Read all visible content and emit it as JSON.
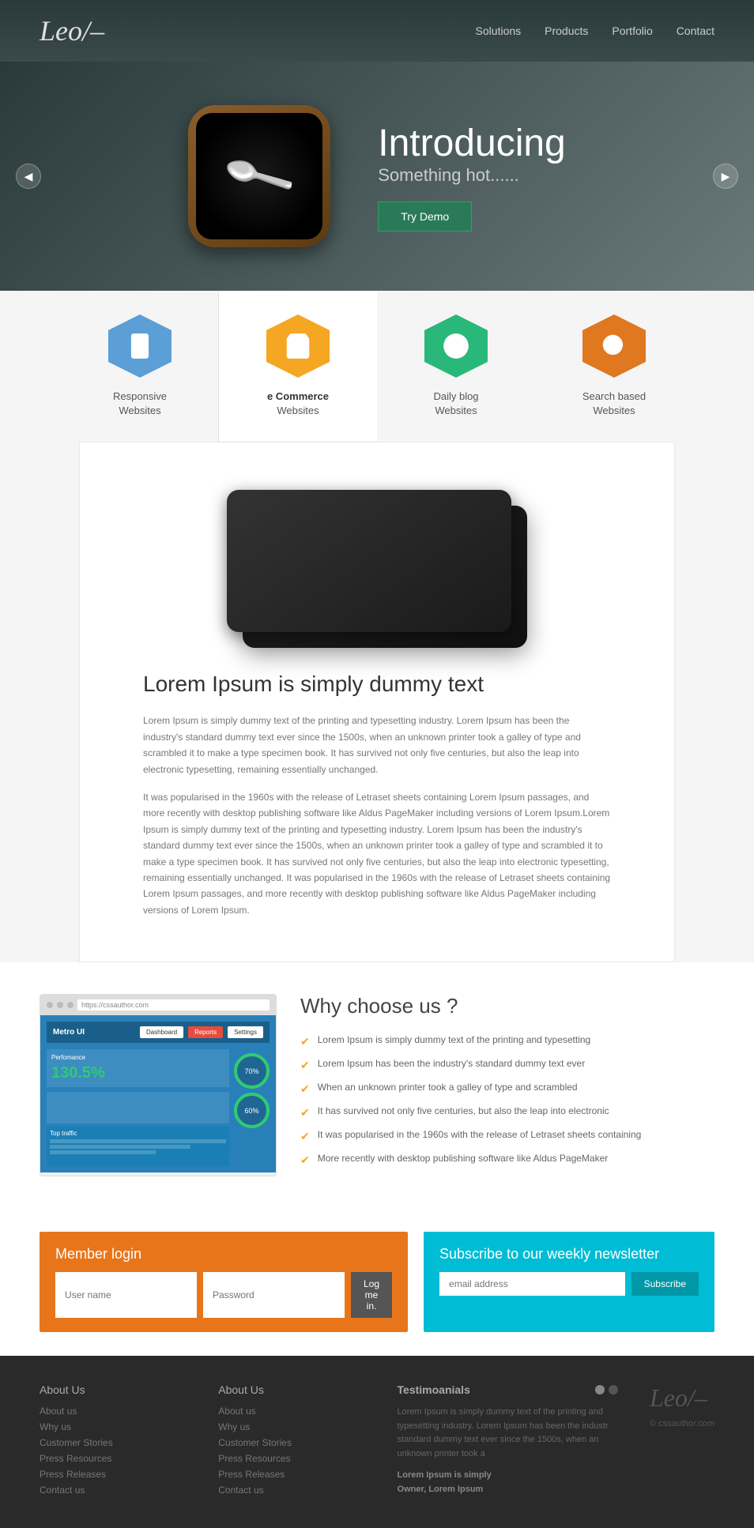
{
  "header": {
    "logo": "Leo/–",
    "nav": [
      {
        "label": "Solutions",
        "href": "#"
      },
      {
        "label": "Products",
        "href": "#"
      },
      {
        "label": "Portfolio",
        "href": "#"
      },
      {
        "label": "Contact",
        "href": "#"
      }
    ]
  },
  "hero": {
    "title": "Introducing",
    "subtitle": "Something hot......",
    "cta_label": "Try Demo",
    "prev_label": "◀",
    "next_label": "▶"
  },
  "features": {
    "tabs": [
      {
        "id": "responsive",
        "label": "Responsive",
        "sublabel": "Websites",
        "color": "hex-blue",
        "icon": "tablet"
      },
      {
        "id": "ecommerce",
        "label": "e Commerce",
        "sublabel": "Websites",
        "color": "hex-yellow",
        "icon": "cart",
        "active": true
      },
      {
        "id": "blog",
        "label": "Daily blog",
        "sublabel": "Websites",
        "color": "hex-green",
        "icon": "globe"
      },
      {
        "id": "search",
        "label": "Search based",
        "sublabel": "Websites",
        "color": "hex-orange",
        "icon": "search"
      }
    ]
  },
  "content": {
    "heading": "Lorem Ipsum is simply dummy text",
    "para1": "Lorem Ipsum is simply dummy text of the printing and typesetting industry. Lorem Ipsum has been the industry's standard dummy text ever since the 1500s, when an unknown printer took a galley of type and scrambled it to make a type specimen book. It has survived not only five centuries, but also the leap into electronic typesetting, remaining essentially unchanged.",
    "para2": "It was popularised in the 1960s with the release of Letraset sheets containing Lorem Ipsum passages, and more recently with desktop publishing software like Aldus PageMaker including versions of Lorem Ipsum.Lorem Ipsum is simply dummy text of the printing and typesetting industry. Lorem Ipsum has been the industry's standard dummy text ever since the 1500s, when an unknown printer took a galley of type and scrambled it to make a type specimen book. It has survived not only five centuries, but also the leap into electronic typesetting, remaining essentially unchanged. It was popularised in the 1960s with the release of Letraset sheets containing Lorem Ipsum passages, and more recently with desktop publishing software like Aldus PageMaker including versions of Lorem Ipsum."
  },
  "why": {
    "heading": "Why choose us ?",
    "items": [
      "Lorem Ipsum is simply dummy text of the printing and typesetting",
      "Lorem Ipsum has been the industry's standard dummy text ever",
      "When an unknown printer took a galley of type and scrambled",
      "It has survived not only five centuries, but also the leap into electronic",
      "It was popularised in the 1960s with the release of Letraset sheets containing",
      "More recently with desktop publishing software like Aldus PageMaker"
    ],
    "screenshot": {
      "url": "https://cssauthor.com",
      "app_name": "Metro UI",
      "performance": "130.5%",
      "chart1": "70%",
      "chart2": "60%"
    }
  },
  "member": {
    "title": "Member login",
    "username_placeholder": "User name",
    "password_placeholder": "Password",
    "button_label": "Log me in."
  },
  "newsletter": {
    "title": "Subscribe to our weekly newsletter",
    "email_placeholder": "email address",
    "button_label": "Subscribe"
  },
  "footer": {
    "col1_title": "About Us",
    "col1_links": [
      "About us",
      "Why us",
      "Customer Stories",
      "Press Resources",
      "Press Releases",
      "Contact us"
    ],
    "col2_title": "About Us",
    "col2_links": [
      "About us",
      "Why us",
      "Customer Stories",
      "Press Resources",
      "Press Releases",
      "Contact us"
    ],
    "testimonial_title": "Testimoanials",
    "testimonial_text": "Lorem Ipsum is simply dummy text of the printing and typesetting industry. Lorem Ipsum has been the industr standard dummy text ever since the 1500s, when an unknown printer took a",
    "testimonial_author_line1": "Lorem Ipsum is simply",
    "testimonial_author_line2": "Owner, Lorem Ipsum",
    "logo": "Leo/–",
    "domain": "© cssauthor.com"
  }
}
